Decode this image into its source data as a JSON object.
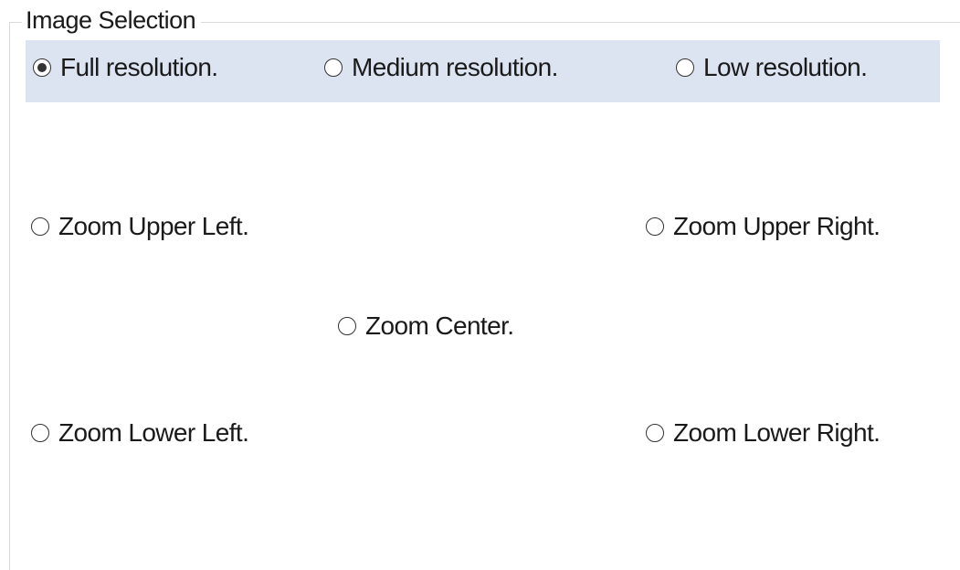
{
  "group": {
    "title": "Image Selection"
  },
  "resolution": {
    "options": [
      {
        "label": "Full resolution.",
        "checked": true
      },
      {
        "label": "Medium resolution.",
        "checked": false
      },
      {
        "label": "Low resolution.",
        "checked": false
      }
    ]
  },
  "zoom": {
    "upper_left": {
      "label": "Zoom Upper Left.",
      "checked": false
    },
    "upper_right": {
      "label": "Zoom Upper Right.",
      "checked": false
    },
    "center": {
      "label": "Zoom Center.",
      "checked": false
    },
    "lower_left": {
      "label": "Zoom Lower Left.",
      "checked": false
    },
    "lower_right": {
      "label": "Zoom Lower Right.",
      "checked": false
    }
  },
  "colors": {
    "highlight": "#dce3f1",
    "border": "#d9d9d9",
    "text": "#1a1a1a"
  }
}
